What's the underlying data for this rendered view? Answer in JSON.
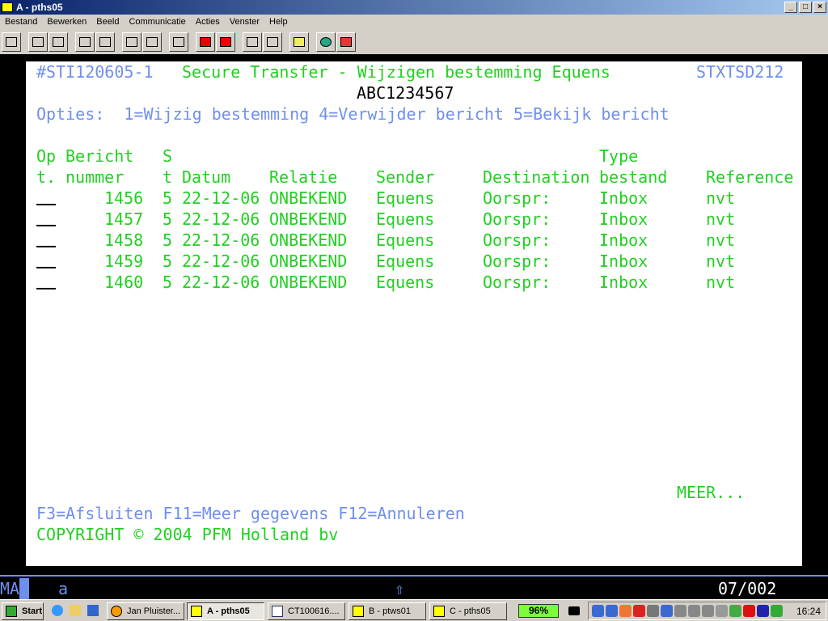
{
  "window": {
    "title": "A - pths05"
  },
  "menu": [
    "Bestand",
    "Bewerken",
    "Beeld",
    "Communicatie",
    "Acties",
    "Venster",
    "Help"
  ],
  "toolbar_icons": [
    "display-icon",
    "copy-icon",
    "paste-icon",
    "send-screen-icon",
    "receive-screen-icon",
    "display-setup-icon",
    "keyboard-map-icon",
    "keyboard-icon",
    "macro-record-icon",
    "macro-stop-icon",
    "macro-play-icon",
    "macro-pause-icon",
    "clipboard-icon",
    "web-help-icon",
    "help-icon"
  ],
  "screen": {
    "program_id": "#STI120605-1",
    "title": "Secure Transfer - Wijzigen bestemming Equens",
    "screen_id": "STXTSD212",
    "subtitle": "ABC1234567",
    "options": "Opties:  1=Wijzig bestemming 4=Verwijder bericht 5=Bekijk bericht",
    "headers1": {
      "op": "Op",
      "bericht": "Bericht",
      "s": "S",
      "type": "Type"
    },
    "headers2": {
      "op": "t.",
      "nummer": "nummer",
      "s": "t",
      "datum": "Datum",
      "relatie": "Relatie",
      "sender": "Sender",
      "destination": "Destination",
      "type": "bestand",
      "reference": "Reference"
    },
    "rows": [
      {
        "nummer": "1456",
        "st": "5",
        "datum": "22-12-06",
        "relatie": "ONBEKEND",
        "sender": "Equens",
        "destination": "Oorspr:",
        "type": "Inbox",
        "reference": "nvt"
      },
      {
        "nummer": "1457",
        "st": "5",
        "datum": "22-12-06",
        "relatie": "ONBEKEND",
        "sender": "Equens",
        "destination": "Oorspr:",
        "type": "Inbox",
        "reference": "nvt"
      },
      {
        "nummer": "1458",
        "st": "5",
        "datum": "22-12-06",
        "relatie": "ONBEKEND",
        "sender": "Equens",
        "destination": "Oorspr:",
        "type": "Inbox",
        "reference": "nvt"
      },
      {
        "nummer": "1459",
        "st": "5",
        "datum": "22-12-06",
        "relatie": "ONBEKEND",
        "sender": "Equens",
        "destination": "Oorspr:",
        "type": "Inbox",
        "reference": "nvt"
      },
      {
        "nummer": "1460",
        "st": "5",
        "datum": "22-12-06",
        "relatie": "ONBEKEND",
        "sender": "Equens",
        "destination": "Oorspr:",
        "type": "Inbox",
        "reference": "nvt"
      }
    ],
    "more": "MEER...",
    "function_keys": "F3=Afsluiten F11=Meer gegevens F12=Annuleren",
    "copyright": "COPYRIGHT © 2004 PFM Holland bv"
  },
  "status": {
    "mode": "MA",
    "indicator": "a",
    "shift": "⇧",
    "cursor_pos": "07/002"
  },
  "taskbar": {
    "start": "Start",
    "tasks": [
      "Jan Pluister...",
      "A - pths05",
      "CT100616....",
      "B - ptws01",
      "C - pths05"
    ],
    "battery": "96%",
    "clock": "16:24"
  }
}
